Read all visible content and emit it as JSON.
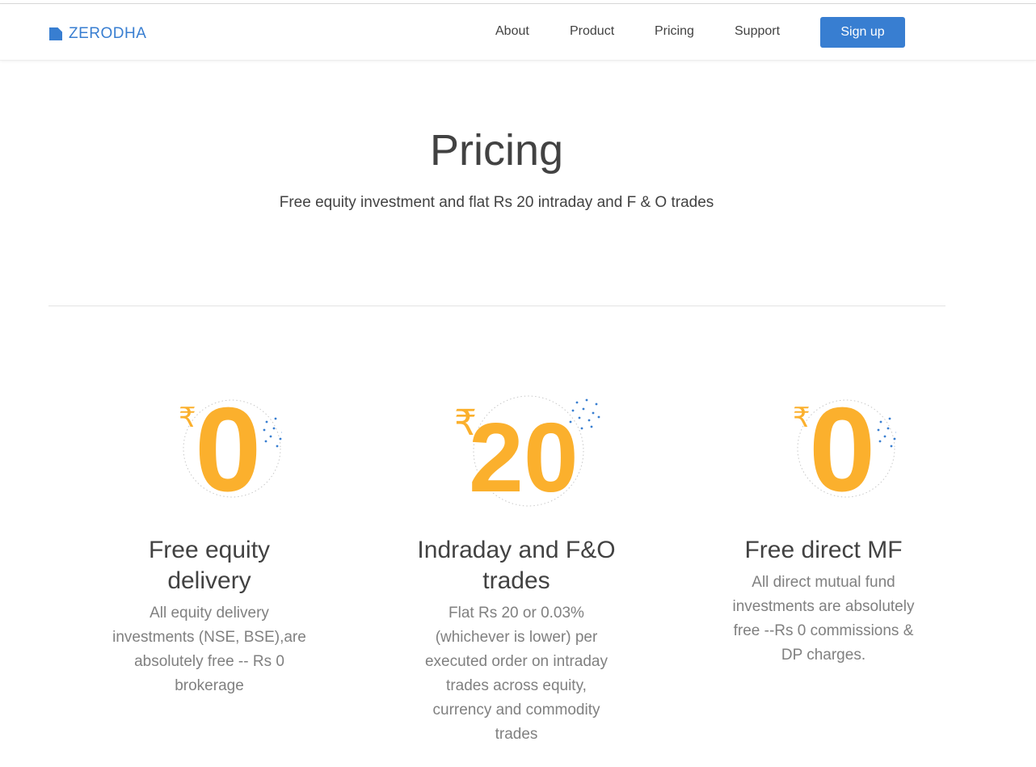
{
  "brand": {
    "name": "ZERODHA",
    "logo_icon": "zerodha-logo-icon",
    "accent": "#387ed1"
  },
  "nav": {
    "items": [
      {
        "label": "About"
      },
      {
        "label": "Product"
      },
      {
        "label": "Pricing"
      },
      {
        "label": "Support"
      }
    ],
    "signup_label": "Sign up"
  },
  "hero": {
    "title": "Pricing",
    "subtitle": "Free equity investment and flat Rs 20 intraday and F & O trades"
  },
  "cards": [
    {
      "currency": "₹",
      "amount": "0",
      "title": "Free equity delivery",
      "description": "All equity delivery investments (NSE, BSE),are absolutely free -- Rs 0 brokerage"
    },
    {
      "currency": "₹",
      "amount": "20",
      "title": "Indraday and F&O trades",
      "description": "Flat Rs 20 or 0.03% (whichever is lower) per executed order on intraday trades across equity, currency and commodity trades"
    },
    {
      "currency": "₹",
      "amount": "0",
      "title": "Free direct MF",
      "description": "All direct mutual fund investments are absolutely free --Rs 0 commissions & DP charges."
    }
  ],
  "colors": {
    "price": "#fbb02d",
    "dots": "#387ed1",
    "text": "#424242",
    "muted": "#808080"
  }
}
